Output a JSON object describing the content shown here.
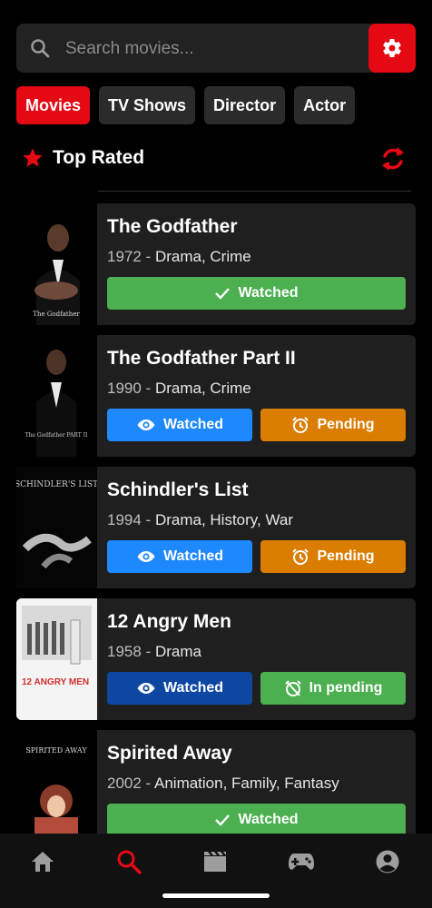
{
  "search": {
    "placeholder": "Search movies..."
  },
  "tabs": [
    {
      "label": "Movies",
      "active": true
    },
    {
      "label": "TV Shows",
      "active": false
    },
    {
      "label": "Director",
      "active": false
    },
    {
      "label": "Actor",
      "active": false
    }
  ],
  "section": {
    "title": "Top Rated"
  },
  "movies": [
    {
      "title": "The Godfather",
      "year": "1972",
      "genres": "Drama, Crime",
      "buttons": [
        {
          "label": "Watched",
          "icon": "check-icon",
          "color": "#4caf50"
        }
      ]
    },
    {
      "title": "The Godfather Part II",
      "year": "1990",
      "genres": "Drama, Crime",
      "buttons": [
        {
          "label": "Watched",
          "icon": "eye-icon",
          "color": "#1e88ff"
        },
        {
          "label": "Pending",
          "icon": "alarm-icon",
          "color": "#da7d00"
        }
      ]
    },
    {
      "title": "Schindler's List",
      "year": "1994",
      "genres": "Drama, History, War",
      "buttons": [
        {
          "label": "Watched",
          "icon": "eye-icon",
          "color": "#1e88ff"
        },
        {
          "label": "Pending",
          "icon": "alarm-icon",
          "color": "#da7d00"
        }
      ]
    },
    {
      "title": "12 Angry Men",
      "year": "1958",
      "genres": "Drama",
      "buttons": [
        {
          "label": "Watched",
          "icon": "eye-icon",
          "color": "#0d47a1"
        },
        {
          "label": "In pending",
          "icon": "alarm-off-icon",
          "color": "#4caf50"
        }
      ]
    },
    {
      "title": "Spirited Away",
      "year": "2002",
      "genres": "Animation, Family, Fantasy",
      "buttons": [
        {
          "label": "Watched",
          "icon": "check-icon",
          "color": "#4caf50"
        }
      ]
    }
  ],
  "posters": [
    {
      "text": "The Godfather"
    },
    {
      "text": "The Godfather PART II"
    },
    {
      "text": "SCHINDLER'S LIST"
    },
    {
      "text": "12 ANGRY MEN"
    },
    {
      "text": "SPIRITED AWAY"
    }
  ],
  "nav": [
    {
      "icon": "home-icon",
      "active": false
    },
    {
      "icon": "search-icon",
      "active": true
    },
    {
      "icon": "movie-icon",
      "active": false
    },
    {
      "icon": "gamepad-icon",
      "active": false
    },
    {
      "icon": "account-icon",
      "active": false
    }
  ],
  "colors": {
    "accent": "#e50914",
    "background": "#000000",
    "card": "#1f1f1f"
  }
}
